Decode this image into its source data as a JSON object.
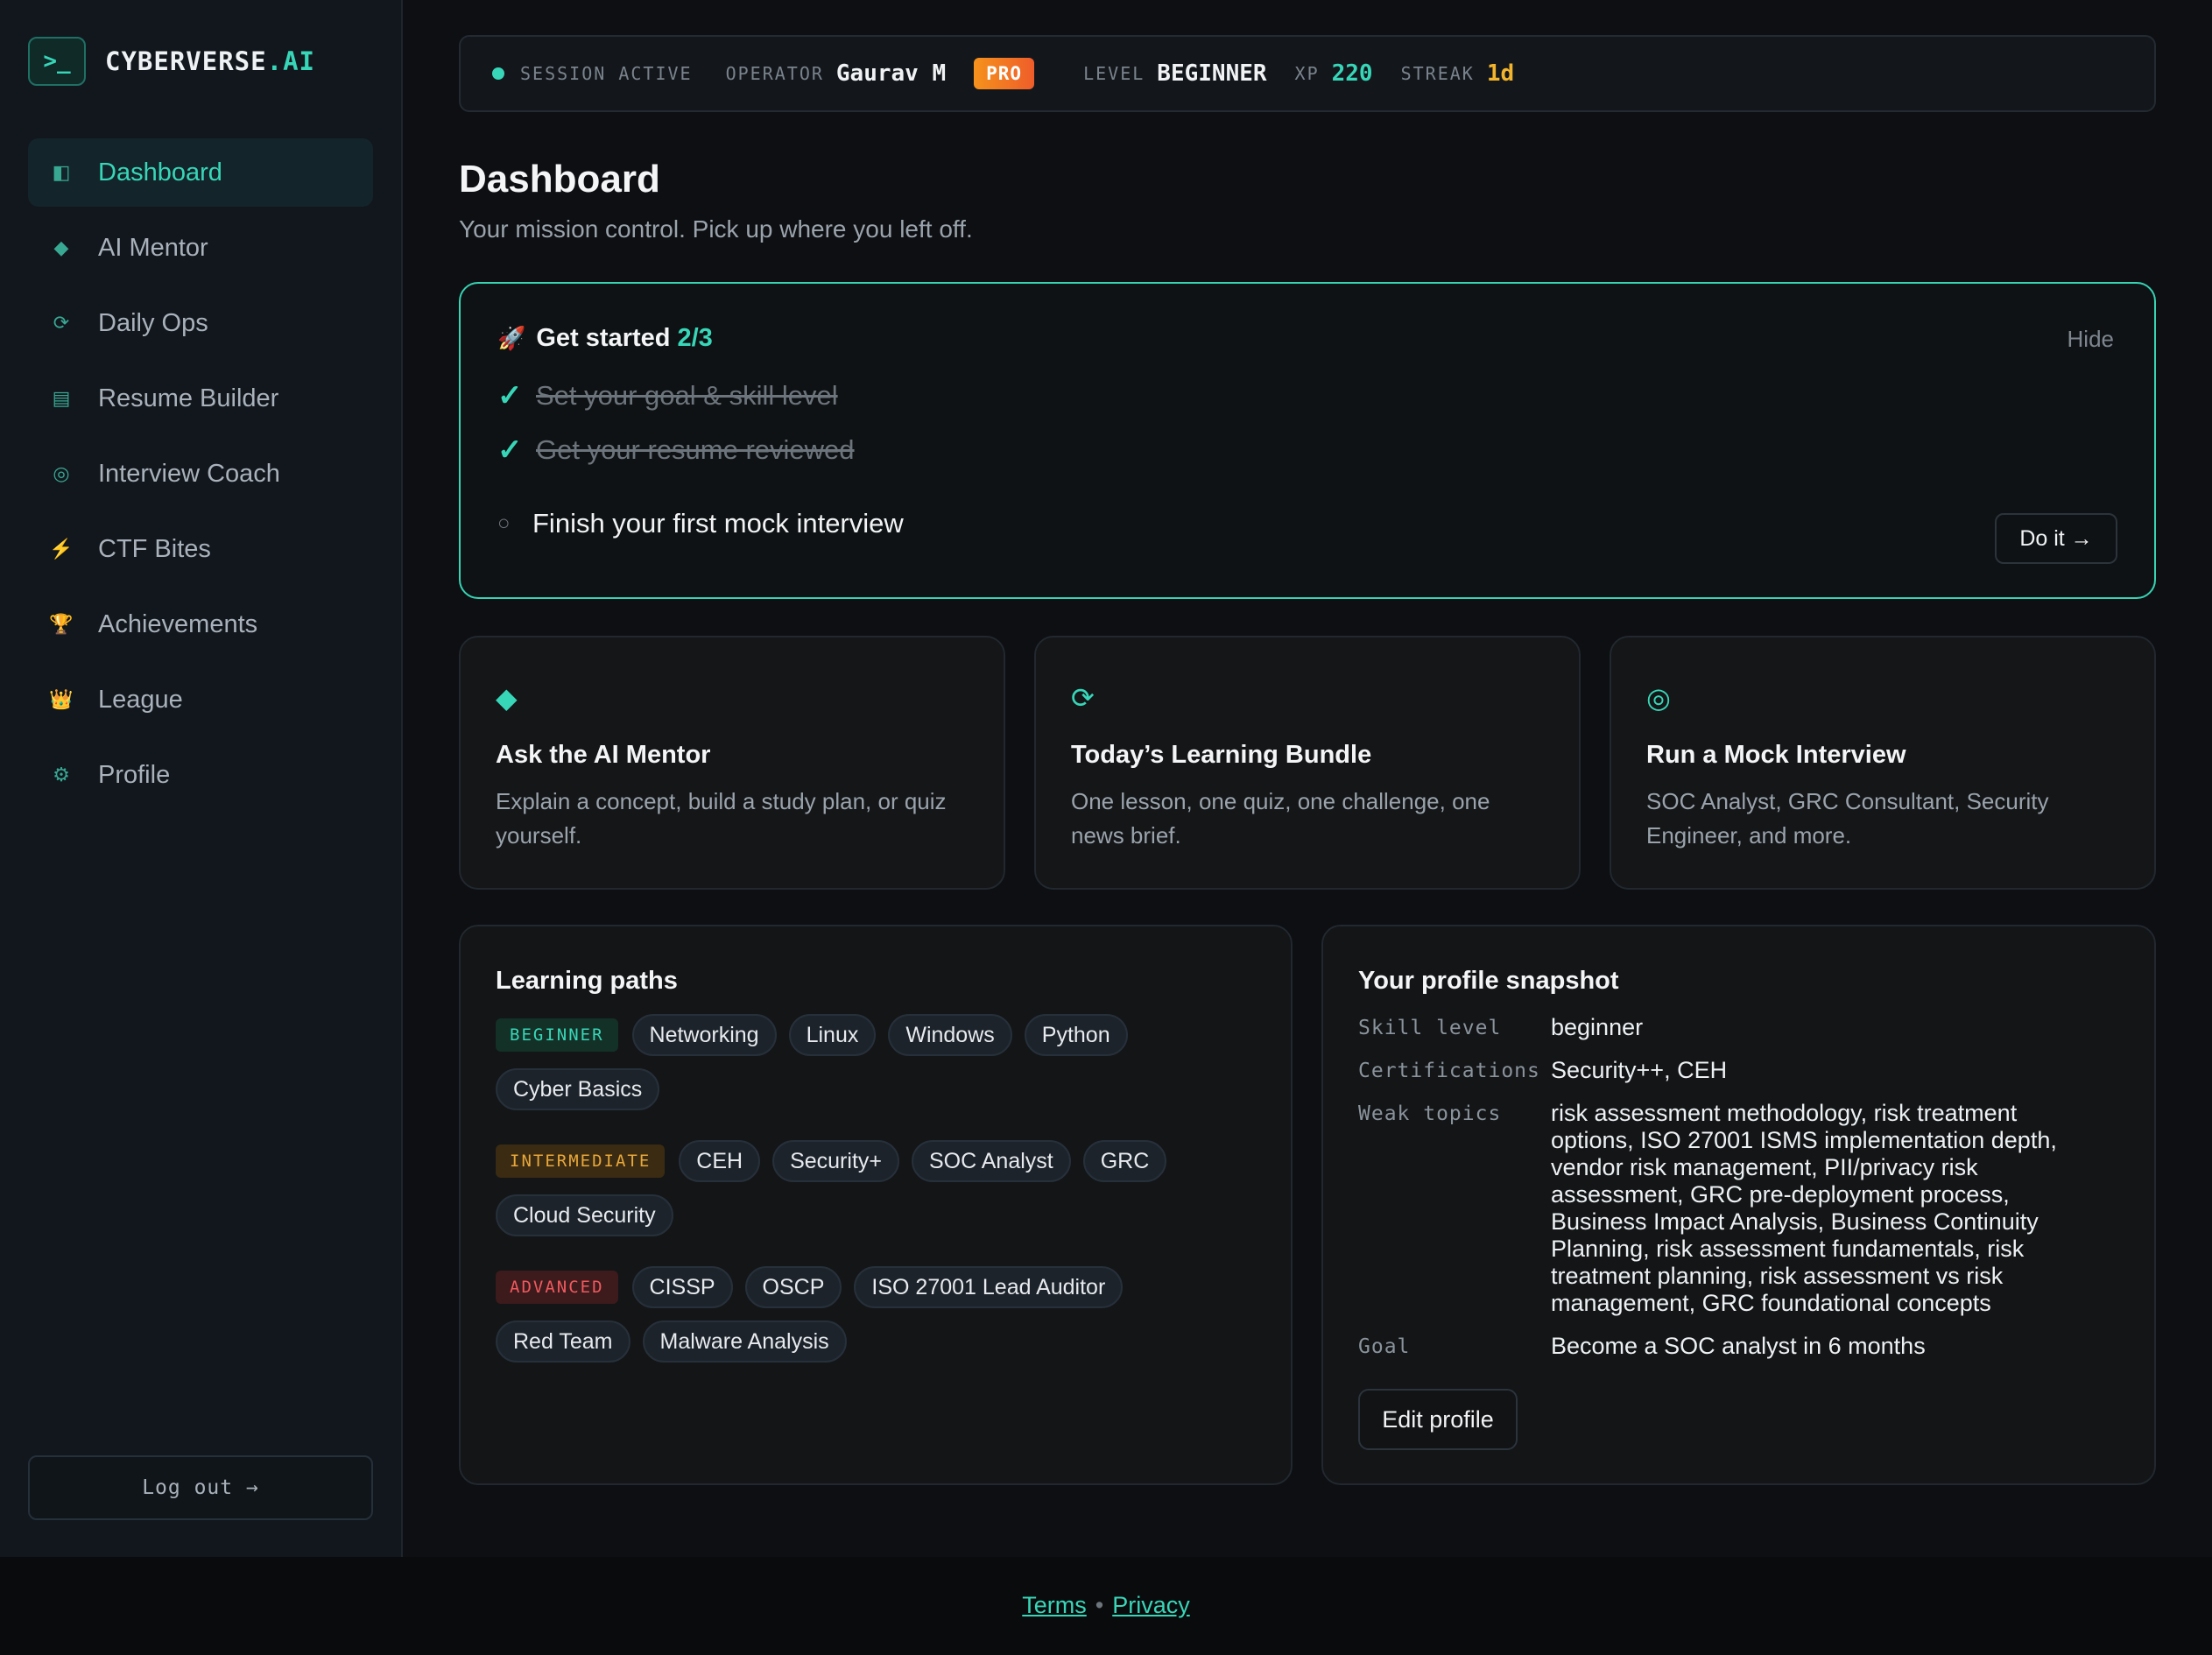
{
  "brand": {
    "badge": ">_",
    "name": "CYBERVERSE",
    "suffix": ".AI"
  },
  "sidebar": {
    "items": [
      {
        "label": "Dashboard",
        "icon": "panel-icon",
        "glyph": "◧",
        "active": true
      },
      {
        "label": "AI Mentor",
        "icon": "diamond-icon",
        "glyph": "◆"
      },
      {
        "label": "Daily Ops",
        "icon": "refresh-icon",
        "glyph": "⟳"
      },
      {
        "label": "Resume Builder",
        "icon": "document-icon",
        "glyph": "▤"
      },
      {
        "label": "Interview Coach",
        "icon": "target-icon",
        "glyph": "◎"
      },
      {
        "label": "CTF Bites",
        "icon": "lightning-icon",
        "glyph": "⚡"
      },
      {
        "label": "Achievements",
        "icon": "trophy-icon",
        "glyph": "🏆"
      },
      {
        "label": "League",
        "icon": "crown-icon",
        "glyph": "👑"
      },
      {
        "label": "Profile",
        "icon": "gear-icon",
        "glyph": "⚙"
      }
    ],
    "logout": "Log out →"
  },
  "topbar": {
    "session": "SESSION ACTIVE",
    "operator_label": "OPERATOR",
    "operator": "Gaurav M",
    "badge": "PRO",
    "level_label": "LEVEL",
    "level": "BEGINNER",
    "xp_label": "XP",
    "xp": "220",
    "streak_label": "STREAK",
    "streak": "1d"
  },
  "page": {
    "title": "Dashboard",
    "subtitle": "Your mission control. Pick up where you left off."
  },
  "get_started": {
    "title": "Get started",
    "progress": "2/3",
    "hide": "Hide",
    "steps": [
      {
        "label": "Set your goal & skill level",
        "done": true
      },
      {
        "label": "Get your resume reviewed",
        "done": true
      },
      {
        "label": "Finish your first mock interview",
        "done": false
      }
    ],
    "action": "Do it →"
  },
  "cards": [
    {
      "icon": "diamond-icon",
      "glyph": "◆",
      "title": "Ask the AI Mentor",
      "text": "Explain a concept, build a study plan, or quiz yourself."
    },
    {
      "icon": "refresh-icon",
      "glyph": "⟳",
      "title": "Today’s Learning Bundle",
      "text": "One lesson, one quiz, one challenge, one news brief."
    },
    {
      "icon": "target-icon",
      "glyph": "◎",
      "title": "Run a Mock Interview",
      "text": "SOC Analyst, GRC Consultant, Security Engineer, and more."
    }
  ],
  "learning_paths": {
    "title": "Learning paths",
    "groups": [
      {
        "level": "BEGINNER",
        "chips": [
          "Networking",
          "Linux",
          "Windows",
          "Python",
          "Cyber Basics"
        ]
      },
      {
        "level": "INTERMEDIATE",
        "chips": [
          "CEH",
          "Security+",
          "SOC Analyst",
          "GRC",
          "Cloud Security"
        ]
      },
      {
        "level": "ADVANCED",
        "chips": [
          "CISSP",
          "OSCP",
          "ISO 27001 Lead Auditor",
          "Red Team",
          "Malware Analysis"
        ]
      }
    ]
  },
  "profile": {
    "title": "Your profile snapshot",
    "rows": [
      {
        "key": "Skill level",
        "value": "beginner"
      },
      {
        "key": "Certifications",
        "value": "Security++, CEH"
      },
      {
        "key": "Weak topics",
        "value": "risk assessment methodology, risk treatment options, ISO 27001 ISMS implementation depth, vendor risk management, PII/privacy risk assessment, GRC pre-deployment process, Business Impact Analysis, Business Continuity Planning, risk assessment fundamentals, risk treatment planning, risk assessment vs risk management, GRC foundational concepts"
      },
      {
        "key": "Goal",
        "value": "Become a SOC analyst in 6 months"
      }
    ],
    "edit": "Edit profile"
  },
  "footer": {
    "terms": "Terms",
    "sep": "•",
    "privacy": "Privacy"
  }
}
